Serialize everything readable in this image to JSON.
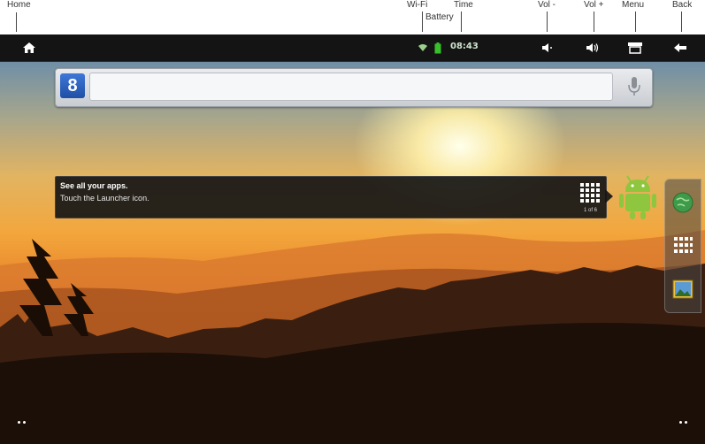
{
  "callouts": {
    "home": "Home",
    "wifi": "Wi-Fi",
    "battery": "Battery",
    "time": "Time",
    "vol_down": "Vol -",
    "vol_up": "Vol +",
    "menu": "Menu",
    "back": "Back"
  },
  "statusbar": {
    "time": "08:43",
    "icons": [
      "home-icon",
      "wifi-icon",
      "battery-icon",
      "volume-down-icon",
      "volume-up-icon",
      "menu-icon",
      "back-icon"
    ]
  },
  "search": {
    "google_label": "8",
    "placeholder": ""
  },
  "tooltip": {
    "title": "See all your apps.",
    "body": "Touch the Launcher icon.",
    "count": "1 of 6"
  },
  "colors": {
    "statusbar_bg": "#141414",
    "battery": "#38c02a",
    "android_green": "#8ec63f"
  }
}
